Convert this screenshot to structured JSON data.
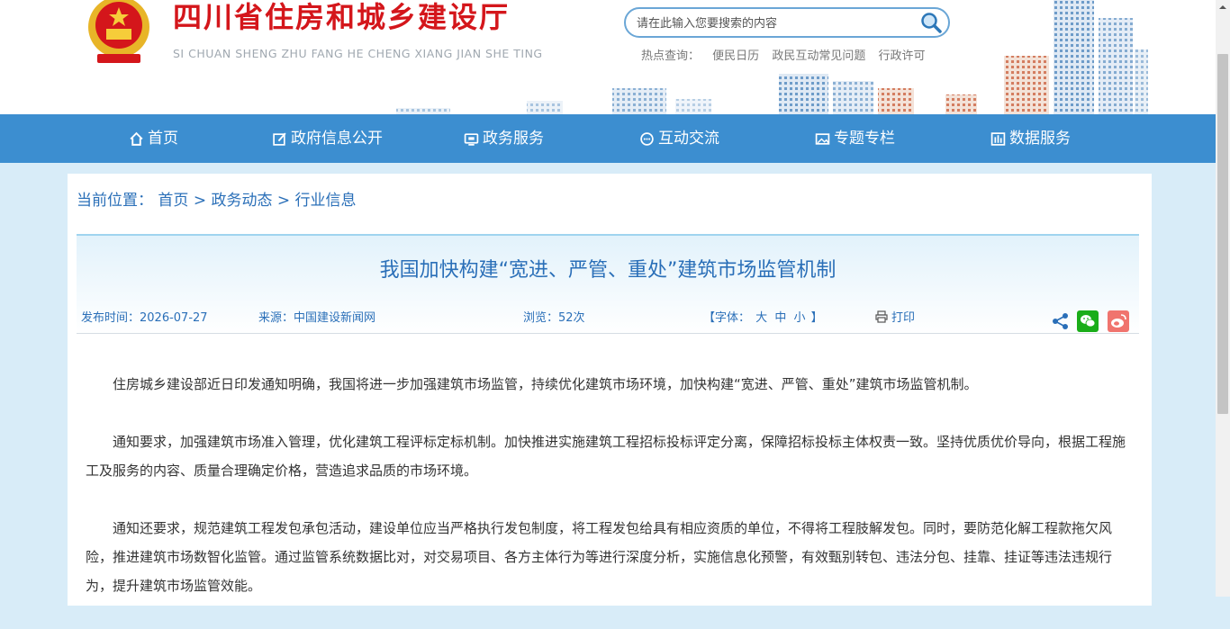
{
  "header": {
    "site_title": "四川省住房和城乡建设厅",
    "site_pinyin": "SI CHUAN SHENG ZHU FANG HE CHENG XIANG JIAN SHE TING",
    "search_placeholder": "请在此输入您要搜索的内容",
    "hot_label": "热点查询：",
    "hot_links": [
      "便民日历",
      "政民互动常见问题",
      "行政许可"
    ]
  },
  "nav": {
    "items": [
      {
        "label": "首页",
        "icon": "home-icon"
      },
      {
        "label": "政府信息公开",
        "icon": "edit-icon"
      },
      {
        "label": "政务服务",
        "icon": "monitor-icon"
      },
      {
        "label": "互动交流",
        "icon": "chat-icon"
      },
      {
        "label": "专题专栏",
        "icon": "image-icon"
      },
      {
        "label": "数据服务",
        "icon": "chart-icon"
      }
    ]
  },
  "breadcrumb": {
    "label": "当前位置：",
    "items": [
      "首页",
      "政务动态",
      "行业信息"
    ],
    "separator": ">"
  },
  "article": {
    "title": "我国加快构建“宽进、严管、重处”建筑市场监管机制",
    "publish_time": "发布时间：2026-07-27",
    "source": "来源：中国建设新闻网",
    "views": "浏览：52次",
    "font_label_open": "【字体：",
    "font_sizes": [
      "大",
      "中",
      "小"
    ],
    "font_label_close": "】",
    "print_label": "打印",
    "paragraphs": [
      "住房城乡建设部近日印发通知明确，我国将进一步加强建筑市场监管，持续优化建筑市场环境，加快构建“宽进、严管、重处”建筑市场监管机制。",
      "通知要求，加强建筑市场准入管理，优化建筑工程评标定标机制。加快推进实施建筑工程招标投标评定分离，保障招标投标主体权责一致。坚持优质优价导向，根据工程施工及服务的内容、质量合理确定价格，营造追求品质的市场环境。",
      "通知还要求，规范建筑工程发包承包活动，建设单位应当严格执行发包制度，将工程发包给具有相应资质的单位，不得将工程肢解发包。同时，要防范化解工程款拖欠风险，推进建筑市场数智化监管。通过监管系统数据比对，对交易项目、各方主体行为等进行深度分析，实施信息化预警，有效甄别转包、违法分包、挂靠、挂证等违法违规行为，提升建筑市场监管效能。"
    ]
  },
  "colors": {
    "title_red": "#d4161b",
    "nav_blue": "#3c8ed0",
    "link_blue": "#2a6fb8",
    "wechat_green": "#1aad19",
    "weibo_red": "#e6162d"
  }
}
